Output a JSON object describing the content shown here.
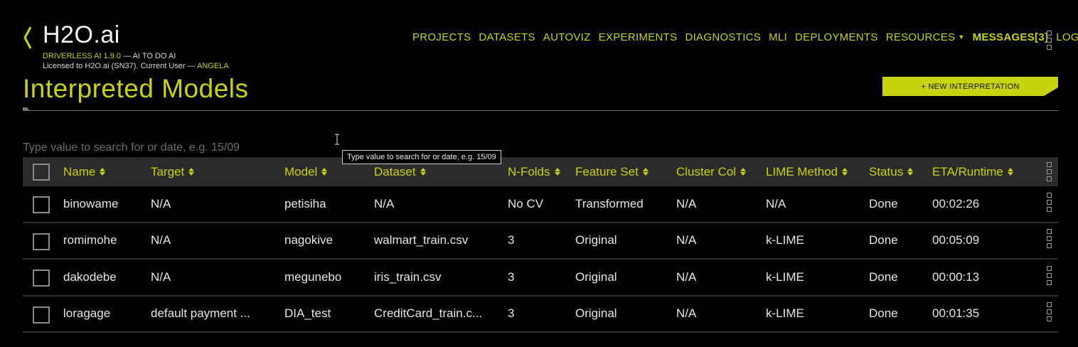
{
  "brand": {
    "logo_text": "H2O.ai",
    "version_line": "DRIVERLESS AI 1.9.0",
    "tagline": " — AI TO DO AI",
    "license_prefix": "Licensed to H2O.ai (SN37). Current User — ",
    "user": "ANGELA"
  },
  "nav": {
    "items": [
      "PROJECTS",
      "DATASETS",
      "AUTOVIZ",
      "EXPERIMENTS",
      "DIAGNOSTICS",
      "MLI",
      "DEPLOYMENTS"
    ],
    "resources": "RESOURCES",
    "messages": "MESSAGES[3]",
    "logout": "LOGOUT"
  },
  "page": {
    "title": "Interpreted Models",
    "new_button": "+ NEW INTERPRETATION"
  },
  "search": {
    "placeholder": "Type value to search for or date, e.g. 15/09",
    "tooltip": "Type value to search for or date, e.g. 15/09"
  },
  "table": {
    "columns": [
      "Name",
      "Target",
      "Model",
      "Dataset",
      "N-Folds",
      "Feature Set",
      "Cluster Col",
      "LIME Method",
      "Status",
      "ETA/Runtime"
    ],
    "rows": [
      [
        "binowame",
        "N/A",
        "petisiha",
        "N/A",
        "No CV",
        "Transformed",
        "N/A",
        "N/A",
        "Done",
        "00:02:26"
      ],
      [
        "romimohe",
        "N/A",
        "nagokive",
        "walmart_train.csv",
        "3",
        "Original",
        "N/A",
        "k-LIME",
        "Done",
        "00:05:09"
      ],
      [
        "dakodebe",
        "N/A",
        "megunebo",
        "iris_train.csv",
        "3",
        "Original",
        "N/A",
        "k-LIME",
        "Done",
        "00:00:13"
      ],
      [
        "loragage",
        "default payment ...",
        "DIA_test",
        "CreditCard_train.c...",
        "3",
        "Original",
        "N/A",
        "k-LIME",
        "Done",
        "00:01:35"
      ]
    ]
  },
  "colors": {
    "accent": "#c8d40f",
    "background": "#000000",
    "header_bg": "#2b2b2b"
  }
}
